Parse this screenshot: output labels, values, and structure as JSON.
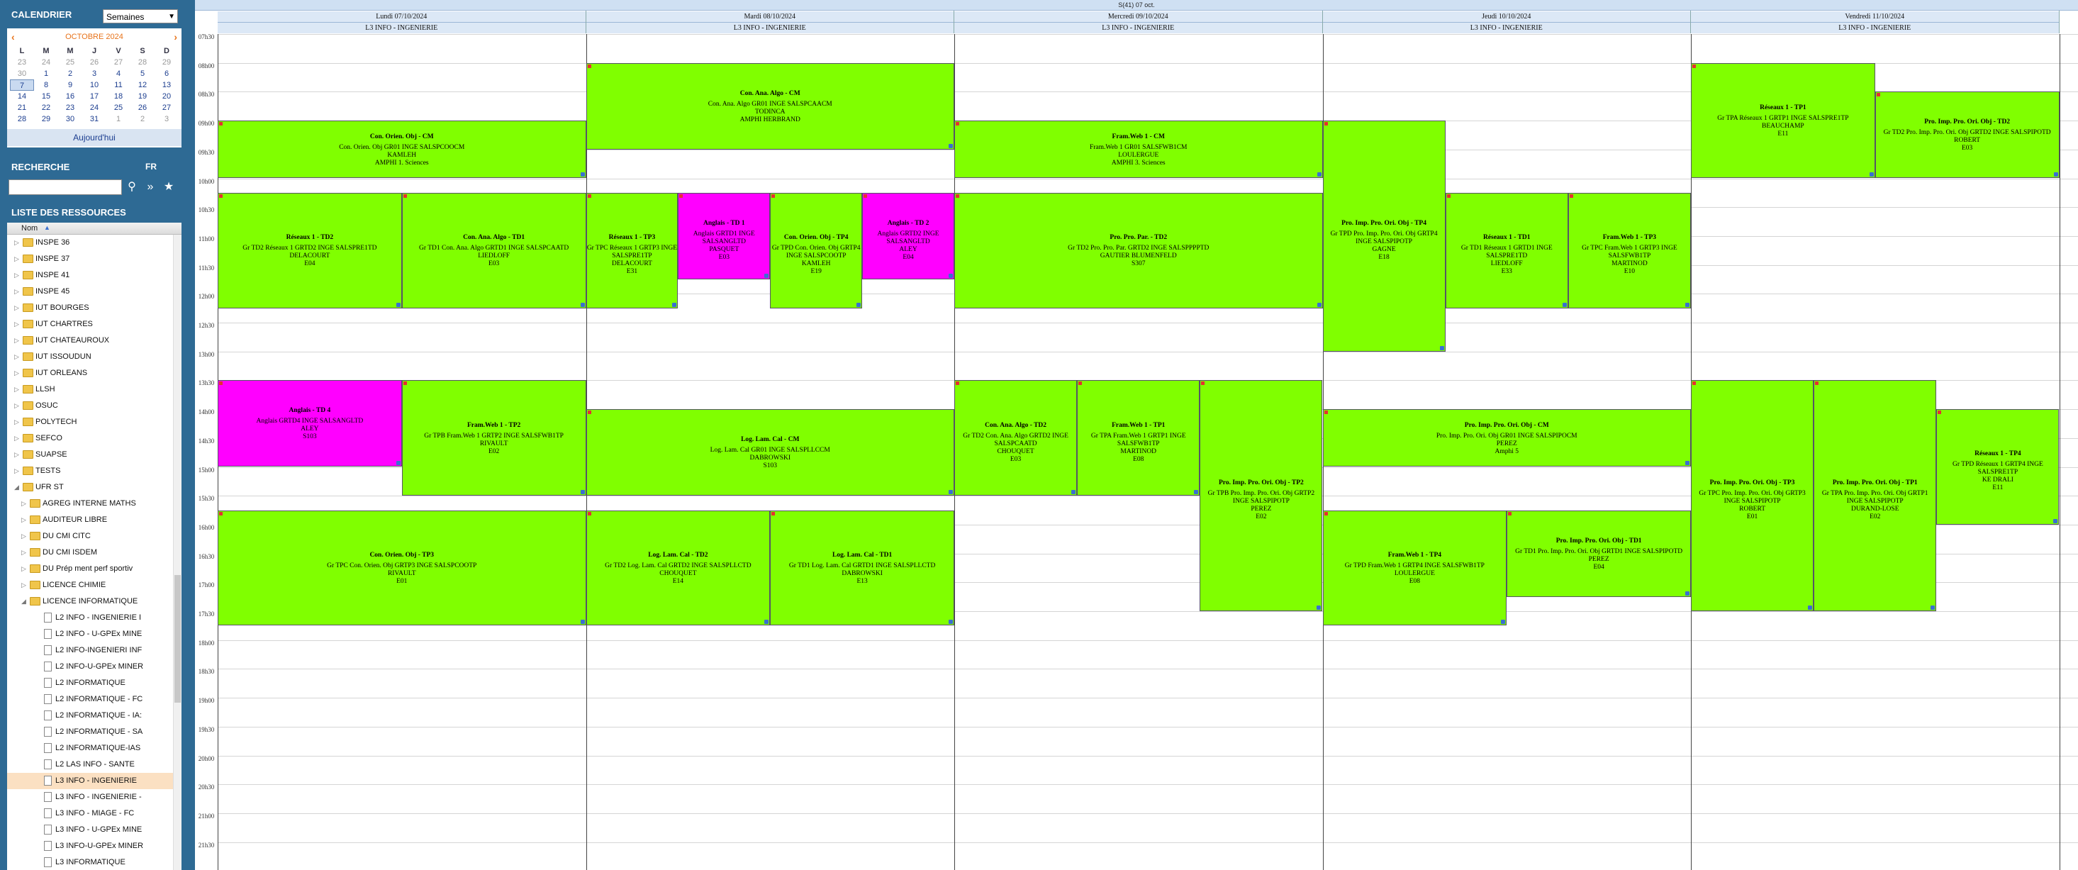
{
  "sidebar": {
    "calendar_title": "CALENDRIER",
    "view_select": "Semaines",
    "month": "OCTOBRE 2024",
    "dow": [
      "L",
      "M",
      "M",
      "J",
      "V",
      "S",
      "D"
    ],
    "weeks": [
      [
        "23",
        "24",
        "25",
        "26",
        "27",
        "28",
        "29"
      ],
      [
        "30",
        "1",
        "2",
        "3",
        "4",
        "5",
        "6"
      ],
      [
        "7",
        "8",
        "9",
        "10",
        "11",
        "12",
        "13"
      ],
      [
        "14",
        "15",
        "16",
        "17",
        "18",
        "19",
        "20"
      ],
      [
        "21",
        "22",
        "23",
        "24",
        "25",
        "26",
        "27"
      ],
      [
        "28",
        "29",
        "30",
        "31",
        "1",
        "2",
        "3"
      ]
    ],
    "today_label": "Aujourd'hui",
    "search_title": "RECHERCHE",
    "search_lang": "FR",
    "resources_title": "LISTE DES RESSOURCES",
    "tree_column": "Nom",
    "tree": [
      {
        "label": "INSPE 36",
        "level": 1,
        "type": "folder",
        "open": false
      },
      {
        "label": "INSPE 37",
        "level": 1,
        "type": "folder",
        "open": false
      },
      {
        "label": "INSPE 41",
        "level": 1,
        "type": "folder",
        "open": false
      },
      {
        "label": "INSPE 45",
        "level": 1,
        "type": "folder",
        "open": false
      },
      {
        "label": "IUT BOURGES",
        "level": 1,
        "type": "folder",
        "open": false
      },
      {
        "label": "IUT CHARTRES",
        "level": 1,
        "type": "folder",
        "open": false
      },
      {
        "label": "IUT CHATEAUROUX",
        "level": 1,
        "type": "folder",
        "open": false
      },
      {
        "label": "IUT ISSOUDUN",
        "level": 1,
        "type": "folder",
        "open": false
      },
      {
        "label": "IUT ORLEANS",
        "level": 1,
        "type": "folder",
        "open": false
      },
      {
        "label": "LLSH",
        "level": 1,
        "type": "folder",
        "open": false
      },
      {
        "label": "OSUC",
        "level": 1,
        "type": "folder",
        "open": false
      },
      {
        "label": "POLYTECH",
        "level": 1,
        "type": "folder",
        "open": false
      },
      {
        "label": "SEFCO",
        "level": 1,
        "type": "folder",
        "open": false
      },
      {
        "label": "SUAPSE",
        "level": 1,
        "type": "folder",
        "open": false
      },
      {
        "label": "TESTS",
        "level": 1,
        "type": "folder",
        "open": false
      },
      {
        "label": "UFR ST",
        "level": 1,
        "type": "folder",
        "open": true
      },
      {
        "label": "AGREG INTERNE MATHS",
        "level": 2,
        "type": "folder",
        "open": false
      },
      {
        "label": "AUDITEUR LIBRE",
        "level": 2,
        "type": "folder",
        "open": false
      },
      {
        "label": "DU CMI CITC",
        "level": 2,
        "type": "folder",
        "open": false
      },
      {
        "label": "DU CMI ISDEM",
        "level": 2,
        "type": "folder",
        "open": false
      },
      {
        "label": "DU Prép ment perf sportiv",
        "level": 2,
        "type": "folder",
        "open": false
      },
      {
        "label": "LICENCE CHIMIE",
        "level": 2,
        "type": "folder",
        "open": false
      },
      {
        "label": "LICENCE INFORMATIQUE",
        "level": 2,
        "type": "folder",
        "open": true
      },
      {
        "label": "L2 INFO - INGENIERIE I",
        "level": 3,
        "type": "file"
      },
      {
        "label": "L2 INFO - U-GPEx MINE",
        "level": 3,
        "type": "file"
      },
      {
        "label": "L2 INFO-INGENIERI INF",
        "level": 3,
        "type": "file"
      },
      {
        "label": "L2 INFO-U-GPEx MINER",
        "level": 3,
        "type": "file"
      },
      {
        "label": "L2 INFORMATIQUE",
        "level": 3,
        "type": "file"
      },
      {
        "label": "L2 INFORMATIQUE - FC",
        "level": 3,
        "type": "file"
      },
      {
        "label": "L2 INFORMATIQUE - IA:",
        "level": 3,
        "type": "file"
      },
      {
        "label": "L2 INFORMATIQUE - SA",
        "level": 3,
        "type": "file"
      },
      {
        "label": "L2 INFORMATIQUE-IAS",
        "level": 3,
        "type": "file"
      },
      {
        "label": "L2 LAS INFO - SANTE",
        "level": 3,
        "type": "file"
      },
      {
        "label": "L3 INFO - INGENIERIE",
        "level": 3,
        "type": "file",
        "active": true
      },
      {
        "label": "L3 INFO - INGENIERIE -",
        "level": 3,
        "type": "file"
      },
      {
        "label": "L3 INFO - MIAGE - FC",
        "level": 3,
        "type": "file"
      },
      {
        "label": "L3 INFO - U-GPEx MINE",
        "level": 3,
        "type": "file"
      },
      {
        "label": "L3 INFO-U-GPEx MINER",
        "level": 3,
        "type": "file"
      },
      {
        "label": "L3 INFORMATIQUE",
        "level": 3,
        "type": "file"
      }
    ]
  },
  "timetable": {
    "week_label": "S(41) 07 oct.",
    "days": [
      {
        "name": "Lundi 07/10/2024",
        "group": "L3 INFO - INGENIERIE"
      },
      {
        "name": "Mardi 08/10/2024",
        "group": "L3 INFO - INGENIERIE"
      },
      {
        "name": "Mercredi 09/10/2024",
        "group": "L3 INFO - INGENIERIE"
      },
      {
        "name": "Jeudi 10/10/2024",
        "group": "L3 INFO - INGENIERIE"
      },
      {
        "name": "Vendredi 11/10/2024",
        "group": "L3 INFO - INGENIERIE"
      }
    ],
    "times": [
      "07h30",
      "08h00",
      "08h30",
      "09h00",
      "09h30",
      "10h00",
      "10h30",
      "11h00",
      "11h30",
      "12h00",
      "12h30",
      "13h00",
      "13h30",
      "14h00",
      "14h30",
      "15h00",
      "15h30",
      "16h00",
      "16h30",
      "17h00",
      "17h30",
      "18h00",
      "18h30",
      "19h00",
      "19h30",
      "20h00",
      "20h30",
      "21h00",
      "21h30"
    ],
    "events": [
      {
        "day": 0,
        "lane": 0,
        "lanes": 1,
        "start": "09:00",
        "end": "10:00",
        "color": "green",
        "title": "Con. Orien. Obj - CM",
        "lines": [
          "Con. Orien. Obj GR01 INGE SALSPCOOCM",
          "KAMLEH",
          "AMPHI 1. Sciences"
        ]
      },
      {
        "day": 0,
        "lane": 0,
        "lanes": 2,
        "start": "10:15",
        "end": "12:15",
        "color": "green",
        "title": "Réseaux 1 - TD2",
        "lines": [
          "Gr TD2 Réseaux 1 GRTD2 INGE SALSPRE1TD",
          "DELACOURT",
          "E04"
        ]
      },
      {
        "day": 0,
        "lane": 1,
        "lanes": 2,
        "start": "10:15",
        "end": "12:15",
        "color": "green",
        "title": "Con. Ana. Algo - TD1",
        "lines": [
          "Gr TD1 Con. Ana. Algo GRTD1 INGE SALSPCAATD",
          "LIEDLOFF",
          "E03"
        ]
      },
      {
        "day": 0,
        "lane": 0,
        "lanes": 2,
        "start": "13:30",
        "end": "15:00",
        "color": "pink",
        "title": "Anglais - TD 4",
        "lines": [
          "Anglais GRTD4 INGE SALSANGLTD",
          "ALEY",
          "S103"
        ]
      },
      {
        "day": 0,
        "lane": 1,
        "lanes": 2,
        "start": "13:30",
        "end": "15:30",
        "color": "green",
        "title": "Fram.Web 1 - TP2",
        "lines": [
          "Gr TPB Fram.Web 1 GRTP2 INGE SALSFWB1TP",
          "RIVAULT",
          "E02"
        ]
      },
      {
        "day": 0,
        "lane": 0,
        "lanes": 1,
        "start": "15:45",
        "end": "17:45",
        "color": "green",
        "title": "Con. Orien. Obj - TP3",
        "lines": [
          "Gr TPC Con. Orien. Obj GRTP3 INGE SALSPCOOTP",
          "RIVAULT",
          "E01"
        ]
      },
      {
        "day": 1,
        "lane": 0,
        "lanes": 1,
        "start": "08:00",
        "end": "09:30",
        "color": "green",
        "title": "Con. Ana. Algo - CM",
        "lines": [
          "Con. Ana. Algo GR01 INGE SALSPCAACM",
          "TODINCA",
          "AMPHI HERBRAND"
        ]
      },
      {
        "day": 1,
        "lane": 0,
        "lanes": 4,
        "start": "10:15",
        "end": "12:15",
        "color": "green",
        "title": "Réseaux 1 - TP3",
        "lines": [
          "Gr TPC Réseaux 1 GRTP3 INGE SALSPRE1TP",
          "DELACOURT",
          "E31"
        ]
      },
      {
        "day": 1,
        "lane": 1,
        "lanes": 4,
        "start": "10:15",
        "end": "11:45",
        "color": "pink",
        "title": "Anglais - TD 1",
        "lines": [
          "Anglais GRTD1 INGE SALSANGLTD",
          "PASQUET",
          "E03"
        ]
      },
      {
        "day": 1,
        "lane": 2,
        "lanes": 4,
        "start": "10:15",
        "end": "12:15",
        "color": "green",
        "title": "Con. Orien. Obj - TP4",
        "lines": [
          "Gr TPD Con. Orien. Obj GRTP4 INGE SALSPCOOTP",
          "KAMLEH",
          "E19"
        ]
      },
      {
        "day": 1,
        "lane": 3,
        "lanes": 4,
        "start": "10:15",
        "end": "11:45",
        "color": "pink",
        "title": "Anglais - TD 2",
        "lines": [
          "Anglais GRTD2 INGE SALSANGLTD",
          "ALEY",
          "E04"
        ]
      },
      {
        "day": 1,
        "lane": 0,
        "lanes": 1,
        "start": "14:00",
        "end": "15:30",
        "color": "green",
        "title": "Log. Lam. Cal - CM",
        "lines": [
          "Log. Lam. Cal GR01 INGE SALSPLLCCM",
          "DABROWSKI",
          "S103"
        ]
      },
      {
        "day": 1,
        "lane": 0,
        "lanes": 2,
        "start": "15:45",
        "end": "17:45",
        "color": "green",
        "title": "Log. Lam. Cal - TD2",
        "lines": [
          "Gr TD2 Log. Lam. Cal GRTD2 INGE SALSPLLCTD",
          "CHOUQUET",
          "E14"
        ]
      },
      {
        "day": 1,
        "lane": 1,
        "lanes": 2,
        "start": "15:45",
        "end": "17:45",
        "color": "green",
        "title": "Log. Lam. Cal - TD1",
        "lines": [
          "Gr TD1 Log. Lam. Cal GRTD1 INGE SALSPLLCTD",
          "DABROWSKI",
          "E13"
        ]
      },
      {
        "day": 2,
        "lane": 0,
        "lanes": 1,
        "start": "09:00",
        "end": "10:00",
        "color": "green",
        "title": "Fram.Web 1 - CM",
        "lines": [
          "Fram.Web 1 GR01 SALSFWB1CM",
          "LOULERGUE",
          "AMPHI 3. Sciences"
        ]
      },
      {
        "day": 2,
        "lane": 0,
        "lanes": 1,
        "start": "10:15",
        "end": "12:15",
        "color": "green",
        "title": "Pro. Pro. Par. - TD2",
        "lines": [
          "Gr TD2 Pro. Pro. Par. GRTD2 INGE SALSPPPPTD",
          "GAUTIER BLUMENFELD",
          "S307"
        ]
      },
      {
        "day": 2,
        "lane": 0,
        "lanes": 3,
        "start": "13:30",
        "end": "15:30",
        "color": "green",
        "title": "Con. Ana. Algo - TD2",
        "lines": [
          "Gr TD2 Con. Ana. Algo GRTD2 INGE SALSPCAATD",
          "CHOUQUET",
          "E03"
        ]
      },
      {
        "day": 2,
        "lane": 1,
        "lanes": 3,
        "start": "13:30",
        "end": "15:30",
        "color": "green",
        "title": "Fram.Web 1 - TP1",
        "lines": [
          "Gr TPA Fram.Web 1 GRTP1 INGE SALSFWB1TP",
          "MARTINOD",
          "E08"
        ]
      },
      {
        "day": 2,
        "lane": 2,
        "lanes": 3,
        "start": "13:30",
        "end": "17:30",
        "color": "green",
        "title": "Pro. Imp. Pro. Ori. Obj - TP2",
        "lines": [
          "Gr TPB Pro. Imp. Pro. Ori. Obj GRTP2 INGE SALSPIPOTP",
          "PEREZ",
          "E02"
        ]
      },
      {
        "day": 3,
        "lane": 0,
        "lanes": 3,
        "start": "09:00",
        "end": "13:00",
        "color": "green",
        "title": "Pro. Imp. Pro. Ori. Obj - TP4",
        "lines": [
          "Gr TPD Pro. Imp. Pro. Ori. Obj GRTP4 INGE SALSPIPOTP",
          "GAGNE",
          "E18"
        ]
      },
      {
        "day": 3,
        "lane": 1,
        "lanes": 3,
        "start": "10:15",
        "end": "12:15",
        "color": "green",
        "title": "Réseaux 1 - TD1",
        "lines": [
          "Gr TD1 Réseaux 1 GRTD1 INGE SALSPRE1TD",
          "LIEDLOFF",
          "E33"
        ]
      },
      {
        "day": 3,
        "lane": 2,
        "lanes": 3,
        "start": "10:15",
        "end": "12:15",
        "color": "green",
        "title": "Fram.Web 1 - TP3",
        "lines": [
          "Gr TPC Fram.Web 1 GRTP3 INGE SALSFWB1TP",
          "MARTINOD",
          "E10"
        ]
      },
      {
        "day": 3,
        "lane": 0,
        "lanes": 1,
        "start": "14:00",
        "end": "15:00",
        "color": "green",
        "title": "Pro. Imp. Pro. Ori. Obj - CM",
        "lines": [
          "Pro. Imp. Pro. Ori. Obj GR01 INGE SALSPIPOCM",
          "PEREZ",
          "Amphi 5"
        ]
      },
      {
        "day": 3,
        "lane": 0,
        "lanes": 2,
        "start": "15:45",
        "end": "17:45",
        "color": "green",
        "title": "Fram.Web 1 - TP4",
        "lines": [
          "Gr TPD Fram.Web 1 GRTP4 INGE SALSFWB1TP",
          "LOULERGUE",
          "E08"
        ]
      },
      {
        "day": 3,
        "lane": 1,
        "lanes": 2,
        "start": "15:45",
        "end": "17:15",
        "color": "green",
        "title": "Pro. Imp. Pro. Ori. Obj - TD1",
        "lines": [
          "Gr TD1 Pro. Imp. Pro. Ori. Obj GRTD1 INGE SALSPIPOTD",
          "PEREZ",
          "E04"
        ]
      },
      {
        "day": 4,
        "lane": 0,
        "lanes": 2,
        "start": "08:00",
        "end": "10:00",
        "color": "green",
        "title": "Réseaux 1 - TP1",
        "lines": [
          "Gr TPA Réseaux 1 GRTP1 INGE SALSPRE1TP",
          "BEAUCHAMP",
          "E11"
        ]
      },
      {
        "day": 4,
        "lane": 1,
        "lanes": 2,
        "start": "08:30",
        "end": "10:00",
        "color": "green",
        "title": "Pro. Imp. Pro. Ori. Obj - TD2",
        "lines": [
          "Gr TD2 Pro. Imp. Pro. Ori. Obj GRTD2 INGE SALSPIPOTD",
          "ROBERT",
          "E03"
        ]
      },
      {
        "day": 4,
        "lane": 0,
        "lanes": 3,
        "start": "13:30",
        "end": "17:30",
        "color": "green",
        "title": "Pro. Imp. Pro. Ori. Obj - TP3",
        "lines": [
          "Gr TPC Pro. Imp. Pro. Ori. Obj GRTP3 INGE SALSPIPOTP",
          "ROBERT",
          "E01"
        ]
      },
      {
        "day": 4,
        "lane": 1,
        "lanes": 3,
        "start": "13:30",
        "end": "17:30",
        "color": "green",
        "title": "Pro. Imp. Pro. Ori. Obj - TP1",
        "lines": [
          "Gr TPA Pro. Imp. Pro. Ori. Obj GRTP1 INGE SALSPIPOTP",
          "DURAND-LOSE",
          "E02"
        ]
      },
      {
        "day": 4,
        "lane": 2,
        "lanes": 3,
        "start": "14:00",
        "end": "16:00",
        "color": "green",
        "title": "Réseaux 1 - TP4",
        "lines": [
          "Gr TPD Réseaux 1 GRTP4 INGE SALSPRE1TP",
          "KE DRALI",
          "E11"
        ]
      }
    ]
  },
  "colors": {
    "event_green": "#80ff00",
    "event_pink": "#ff00ff",
    "sidebar": "#2e6a94",
    "accent_orange": "#e8731a"
  }
}
